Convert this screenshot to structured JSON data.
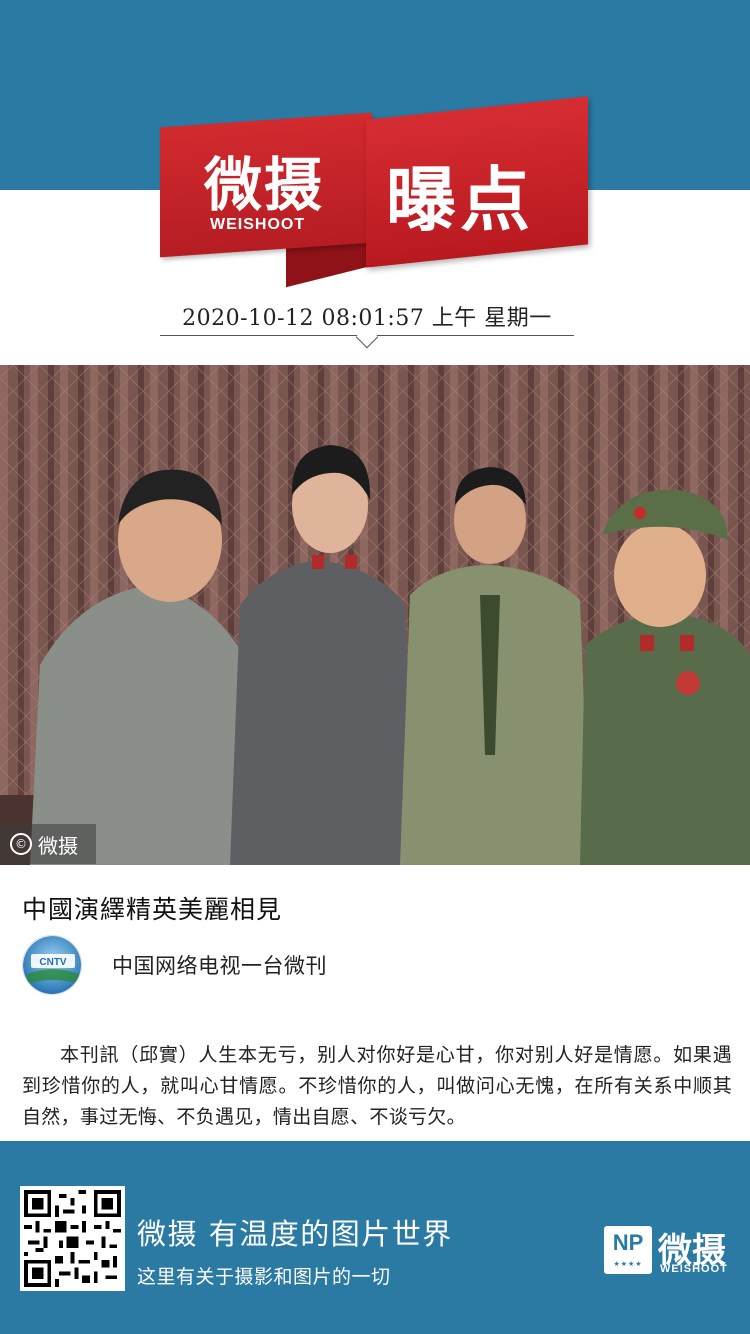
{
  "header": {
    "logo_text": "微摄",
    "logo_sub": "WEISHOOT",
    "logo_tag": "曝点"
  },
  "datetime": {
    "text": "2020-10-12  08:01:57   上午    星期一"
  },
  "photo": {
    "watermark_symbol": "©",
    "watermark_text": "微摄"
  },
  "article": {
    "title": "中國演繹精英美麗相見",
    "author": "中国网络电视一台微刊",
    "author_logo_text": "CNTV",
    "body": "本刊訊（邱實）人生本无亏，别人对你好是心甘，你对别人好是情愿。如果遇到珍惜你的人，就叫心甘情愿。不珍惜你的人，叫做问心无愧，在所有关系中顺其自然，事过无悔、不负遇见，情出自愿、不谈亏欠。"
  },
  "footer": {
    "slogan": "微摄  有温度的图片世界",
    "subline": "这里有关于摄影和图片的一切",
    "np_logo": "NP",
    "np_stars": "★★★★",
    "brand": "微摄",
    "brand_sub": "WEISHOOT"
  },
  "colors": {
    "band_blue": "#2a7aa3",
    "logo_red": "#c8232a"
  }
}
